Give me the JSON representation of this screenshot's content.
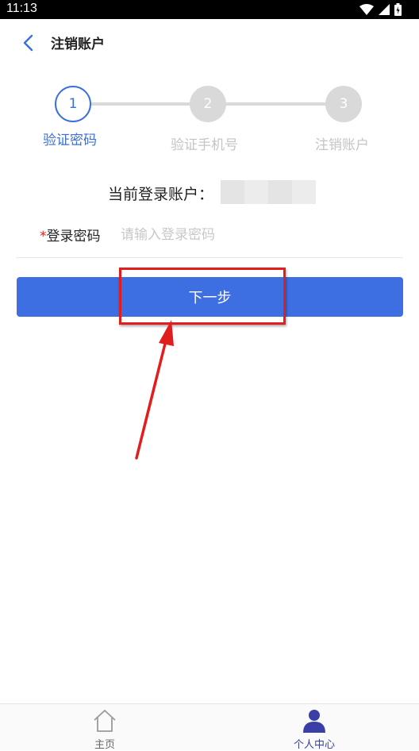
{
  "status_bar": {
    "time": "11:13"
  },
  "header": {
    "title": "注销账户"
  },
  "stepper": {
    "steps": [
      {
        "number": "1",
        "label": "验证密码"
      },
      {
        "number": "2",
        "label": "验证手机号"
      },
      {
        "number": "3",
        "label": "注销账户"
      }
    ],
    "active_step": 1
  },
  "account": {
    "label": "当前登录账户："
  },
  "password": {
    "required_mark": "*",
    "label": "登录密码",
    "placeholder": "请输入登录密码",
    "value": ""
  },
  "next_button": {
    "label": "下一步"
  },
  "tabbar": {
    "items": [
      {
        "label": "主页",
        "icon": "home-icon"
      },
      {
        "label": "个人中心",
        "icon": "person-icon"
      }
    ]
  },
  "colors": {
    "accent": "#3d6fe3",
    "highlight": "#e01e1e",
    "inactive": "#d9d9d9"
  }
}
